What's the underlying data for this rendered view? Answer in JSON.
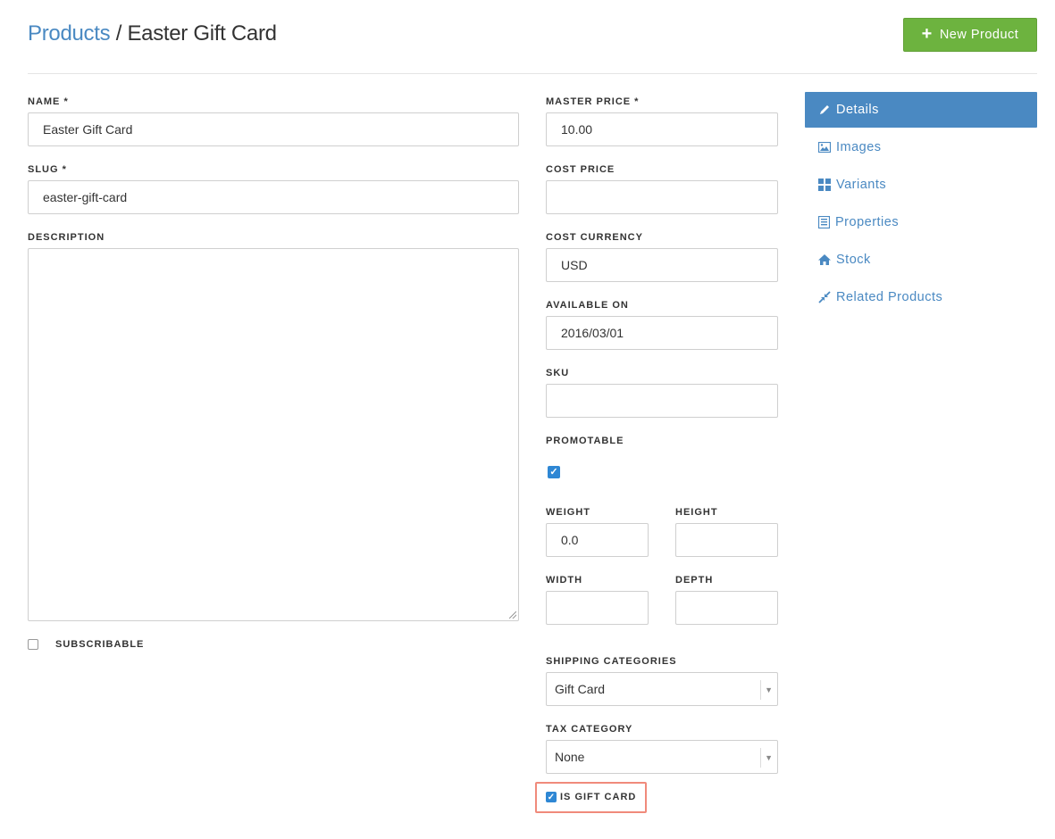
{
  "header": {
    "breadcrumb_link": "Products",
    "separator": "/",
    "current": "Easter Gift Card",
    "new_button_label": "New Product",
    "new_button_icon": "plus-icon"
  },
  "form": {
    "name_label": "NAME *",
    "name_value": "Easter Gift Card",
    "slug_label": "SLUG *",
    "slug_value": "easter-gift-card",
    "description_label": "DESCRIPTION",
    "description_value": "",
    "subscribable_label": "SUBSCRIBABLE",
    "subscribable_checked": false,
    "master_price_label": "MASTER PRICE *",
    "master_price_value": "10.00",
    "cost_price_label": "COST PRICE",
    "cost_price_value": "",
    "cost_currency_label": "COST CURRENCY",
    "cost_currency_value": "USD",
    "available_on_label": "AVAILABLE ON",
    "available_on_value": "2016/03/01",
    "sku_label": "SKU",
    "sku_value": "",
    "promotable_label": "PROMOTABLE",
    "promotable_checked": true,
    "weight_label": "WEIGHT",
    "weight_value": "0.0",
    "height_label": "HEIGHT",
    "height_value": "",
    "width_label": "WIDTH",
    "width_value": "",
    "depth_label": "DEPTH",
    "depth_value": "",
    "shipping_categories_label": "SHIPPING CATEGORIES",
    "shipping_categories_value": "Gift Card",
    "tax_category_label": "TAX CATEGORY",
    "tax_category_value": "None",
    "is_gift_card_label": "IS GIFT CARD",
    "is_gift_card_checked": true
  },
  "sidebar": {
    "items": [
      {
        "label": "Details",
        "icon": "pencil-icon",
        "active": true
      },
      {
        "label": "Images",
        "icon": "picture-icon",
        "active": false
      },
      {
        "label": "Variants",
        "icon": "grid-icon",
        "active": false
      },
      {
        "label": "Properties",
        "icon": "list-icon",
        "active": false
      },
      {
        "label": "Stock",
        "icon": "home-icon",
        "active": false
      },
      {
        "label": "Related Products",
        "icon": "arrows-in-icon",
        "active": false
      }
    ]
  },
  "colors": {
    "accent": "#4a89c2",
    "success": "#6db33f",
    "checkbox": "#2e87d4",
    "highlight": "#f08a7b"
  }
}
